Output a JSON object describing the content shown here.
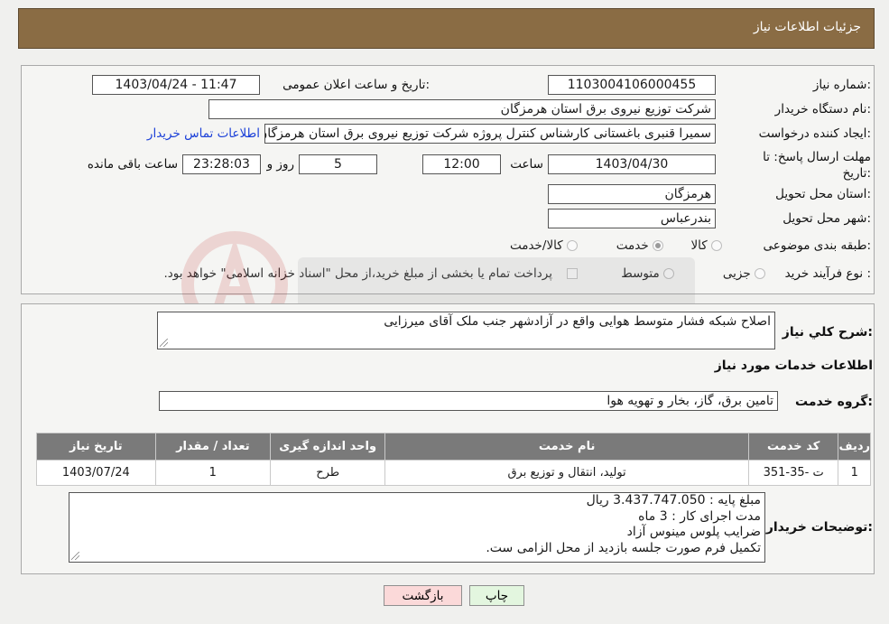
{
  "header": {
    "title": "جزئیات اطلاعات نیاز"
  },
  "form": {
    "need_number_label": "شماره نیاز:",
    "need_number": "1103004106000455",
    "announce_label": "تاریخ و ساعت اعلان عمومی:",
    "announce_value": "1403/04/24 - 11:47",
    "buyer_org_label": "نام دستگاه خریدار:",
    "buyer_org": "شرکت توزیع نیروی برق استان هرمزگان",
    "creator_label": "ایجاد کننده درخواست:",
    "creator": "سمیرا قنبری باغستانی کارشناس کنترل پروژه شرکت توزیع نیروی برق استان هرمزگان",
    "contact_link": "اطلاعات تماس خریدار",
    "deadline_label": "مهلت ارسال پاسخ: تا تاریخ:",
    "deadline_date": "1403/04/30",
    "time_label": "ساعت",
    "deadline_time": "12:00",
    "days_value": "5",
    "days_label": "روز و",
    "remaining_time": "23:28:03",
    "remaining_label": "ساعت باقی مانده",
    "province_label": "استان محل تحویل:",
    "province": "هرمزگان",
    "city_label": "شهر محل تحویل:",
    "city": "بندرعباس",
    "category_label": "طبقه بندی موضوعی:",
    "category_options": [
      "کالا",
      "خدمت",
      "کالا/خدمت"
    ],
    "category_selected": "خدمت",
    "process_label": "نوع فرآیند خرید :",
    "process_options": [
      "جزیی",
      "متوسط"
    ],
    "payment_note": "پرداخت تمام یا بخشی از مبلغ خرید،از محل \"اسناد خزانه اسلامی\" خواهد بود."
  },
  "details": {
    "summary_label": "شرح کلي نياز:",
    "summary": "اصلاح شبکه فشار متوسط هوایی واقع در آزادشهر جنب ملک آقای میرزایی",
    "services_title": "اطلاعات خدمات مورد نیاز",
    "service_group_label": "گروه خدمت:",
    "service_group": "تامین برق، گاز، بخار و تهویه هوا",
    "table": {
      "headers": [
        "ردیف",
        "کد خدمت",
        "نام خدمت",
        "واحد اندازه گیری",
        "تعداد / مقدار",
        "تاریخ نیاز"
      ],
      "rows": [
        [
          "1",
          "ت -35-351",
          "تولید، انتقال و توزیع برق",
          "طرح",
          "1",
          "1403/07/24"
        ]
      ]
    },
    "buyer_notes_label": "توضیحات خریدار:",
    "buyer_notes": [
      "مبلغ پایه : 3.437.747.050 ریال",
      "مدت اجرای کار : 3 ماه",
      "ضرایب پلوس مینوس آزاد",
      "تکمیل فرم صورت جلسه بازدید از محل الزامی ست."
    ]
  },
  "buttons": {
    "print": "چاپ",
    "back": "بازگشت"
  },
  "colors": {
    "header_bg": "#8a6c44",
    "back_button_bg": "#fbd9d9",
    "print_button_bg": "#e3f6df",
    "table_header_bg": "#7a7a7a",
    "link": "#1a3fd8"
  }
}
